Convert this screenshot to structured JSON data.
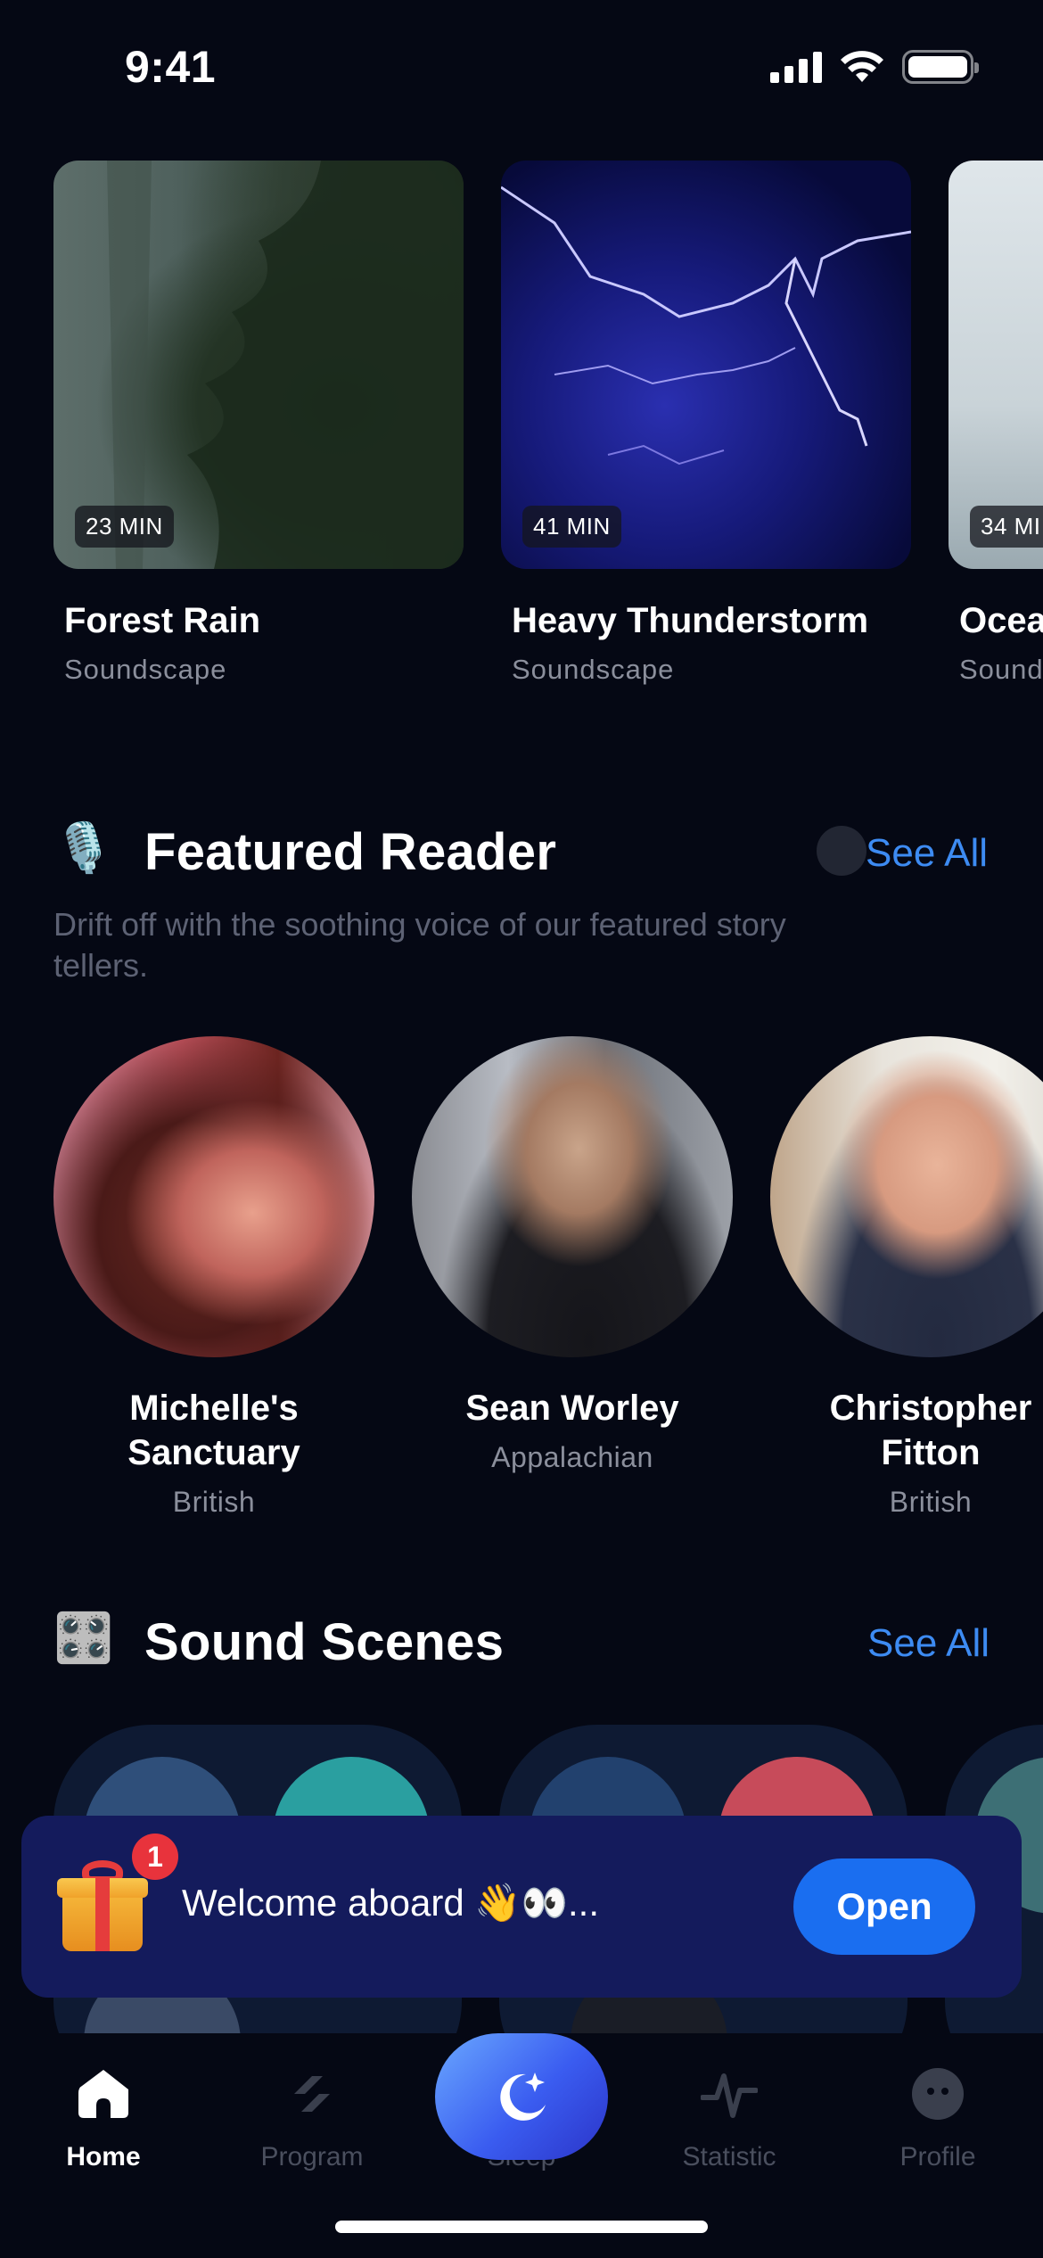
{
  "status_bar": {
    "time": "9:41"
  },
  "soundscapes": [
    {
      "title": "Forest Rain",
      "category": "Soundscape",
      "duration": "23 MIN",
      "image": "forest-rain-photo"
    },
    {
      "title": "Heavy Thunderstorm",
      "category": "Soundscape",
      "duration": "41 MIN",
      "image": "lightning-storm-photo"
    },
    {
      "title": "Ocea",
      "category": "Sound",
      "duration": "34 MI",
      "image": "ocean-photo"
    }
  ],
  "featured_reader": {
    "emoji": "🎙️",
    "title": "Featured Reader",
    "see_all": "See All",
    "description": "Drift off with the soothing voice of our featured story tellers.",
    "readers": [
      {
        "name": "Michelle's Sanctuary",
        "accent": "British"
      },
      {
        "name": "Sean Worley",
        "accent": "Appalachian"
      },
      {
        "name": "Christopher Fitton",
        "accent": "British"
      }
    ]
  },
  "sound_scenes": {
    "emoji": "🎛️",
    "title": "Sound Scenes",
    "see_all": "See All"
  },
  "welcome_banner": {
    "badge_count": "1",
    "text": "Welcome aboard 👋👀...",
    "button": "Open"
  },
  "tab_bar": {
    "tabs": [
      {
        "label": "Home",
        "icon": "home-icon",
        "active": true
      },
      {
        "label": "Program",
        "icon": "program-icon",
        "active": false
      },
      {
        "label": "Sleep",
        "icon": "moon-star-icon",
        "active": false
      },
      {
        "label": "Statistic",
        "icon": "pulse-icon",
        "active": false
      },
      {
        "label": "Profile",
        "icon": "profile-face-icon",
        "active": false
      }
    ]
  },
  "colors": {
    "background": "#050814",
    "accent_link": "#3d8bf2",
    "banner_bg": "#141b5c",
    "open_button": "#1a6ef0",
    "badge_red": "#e8333c"
  }
}
